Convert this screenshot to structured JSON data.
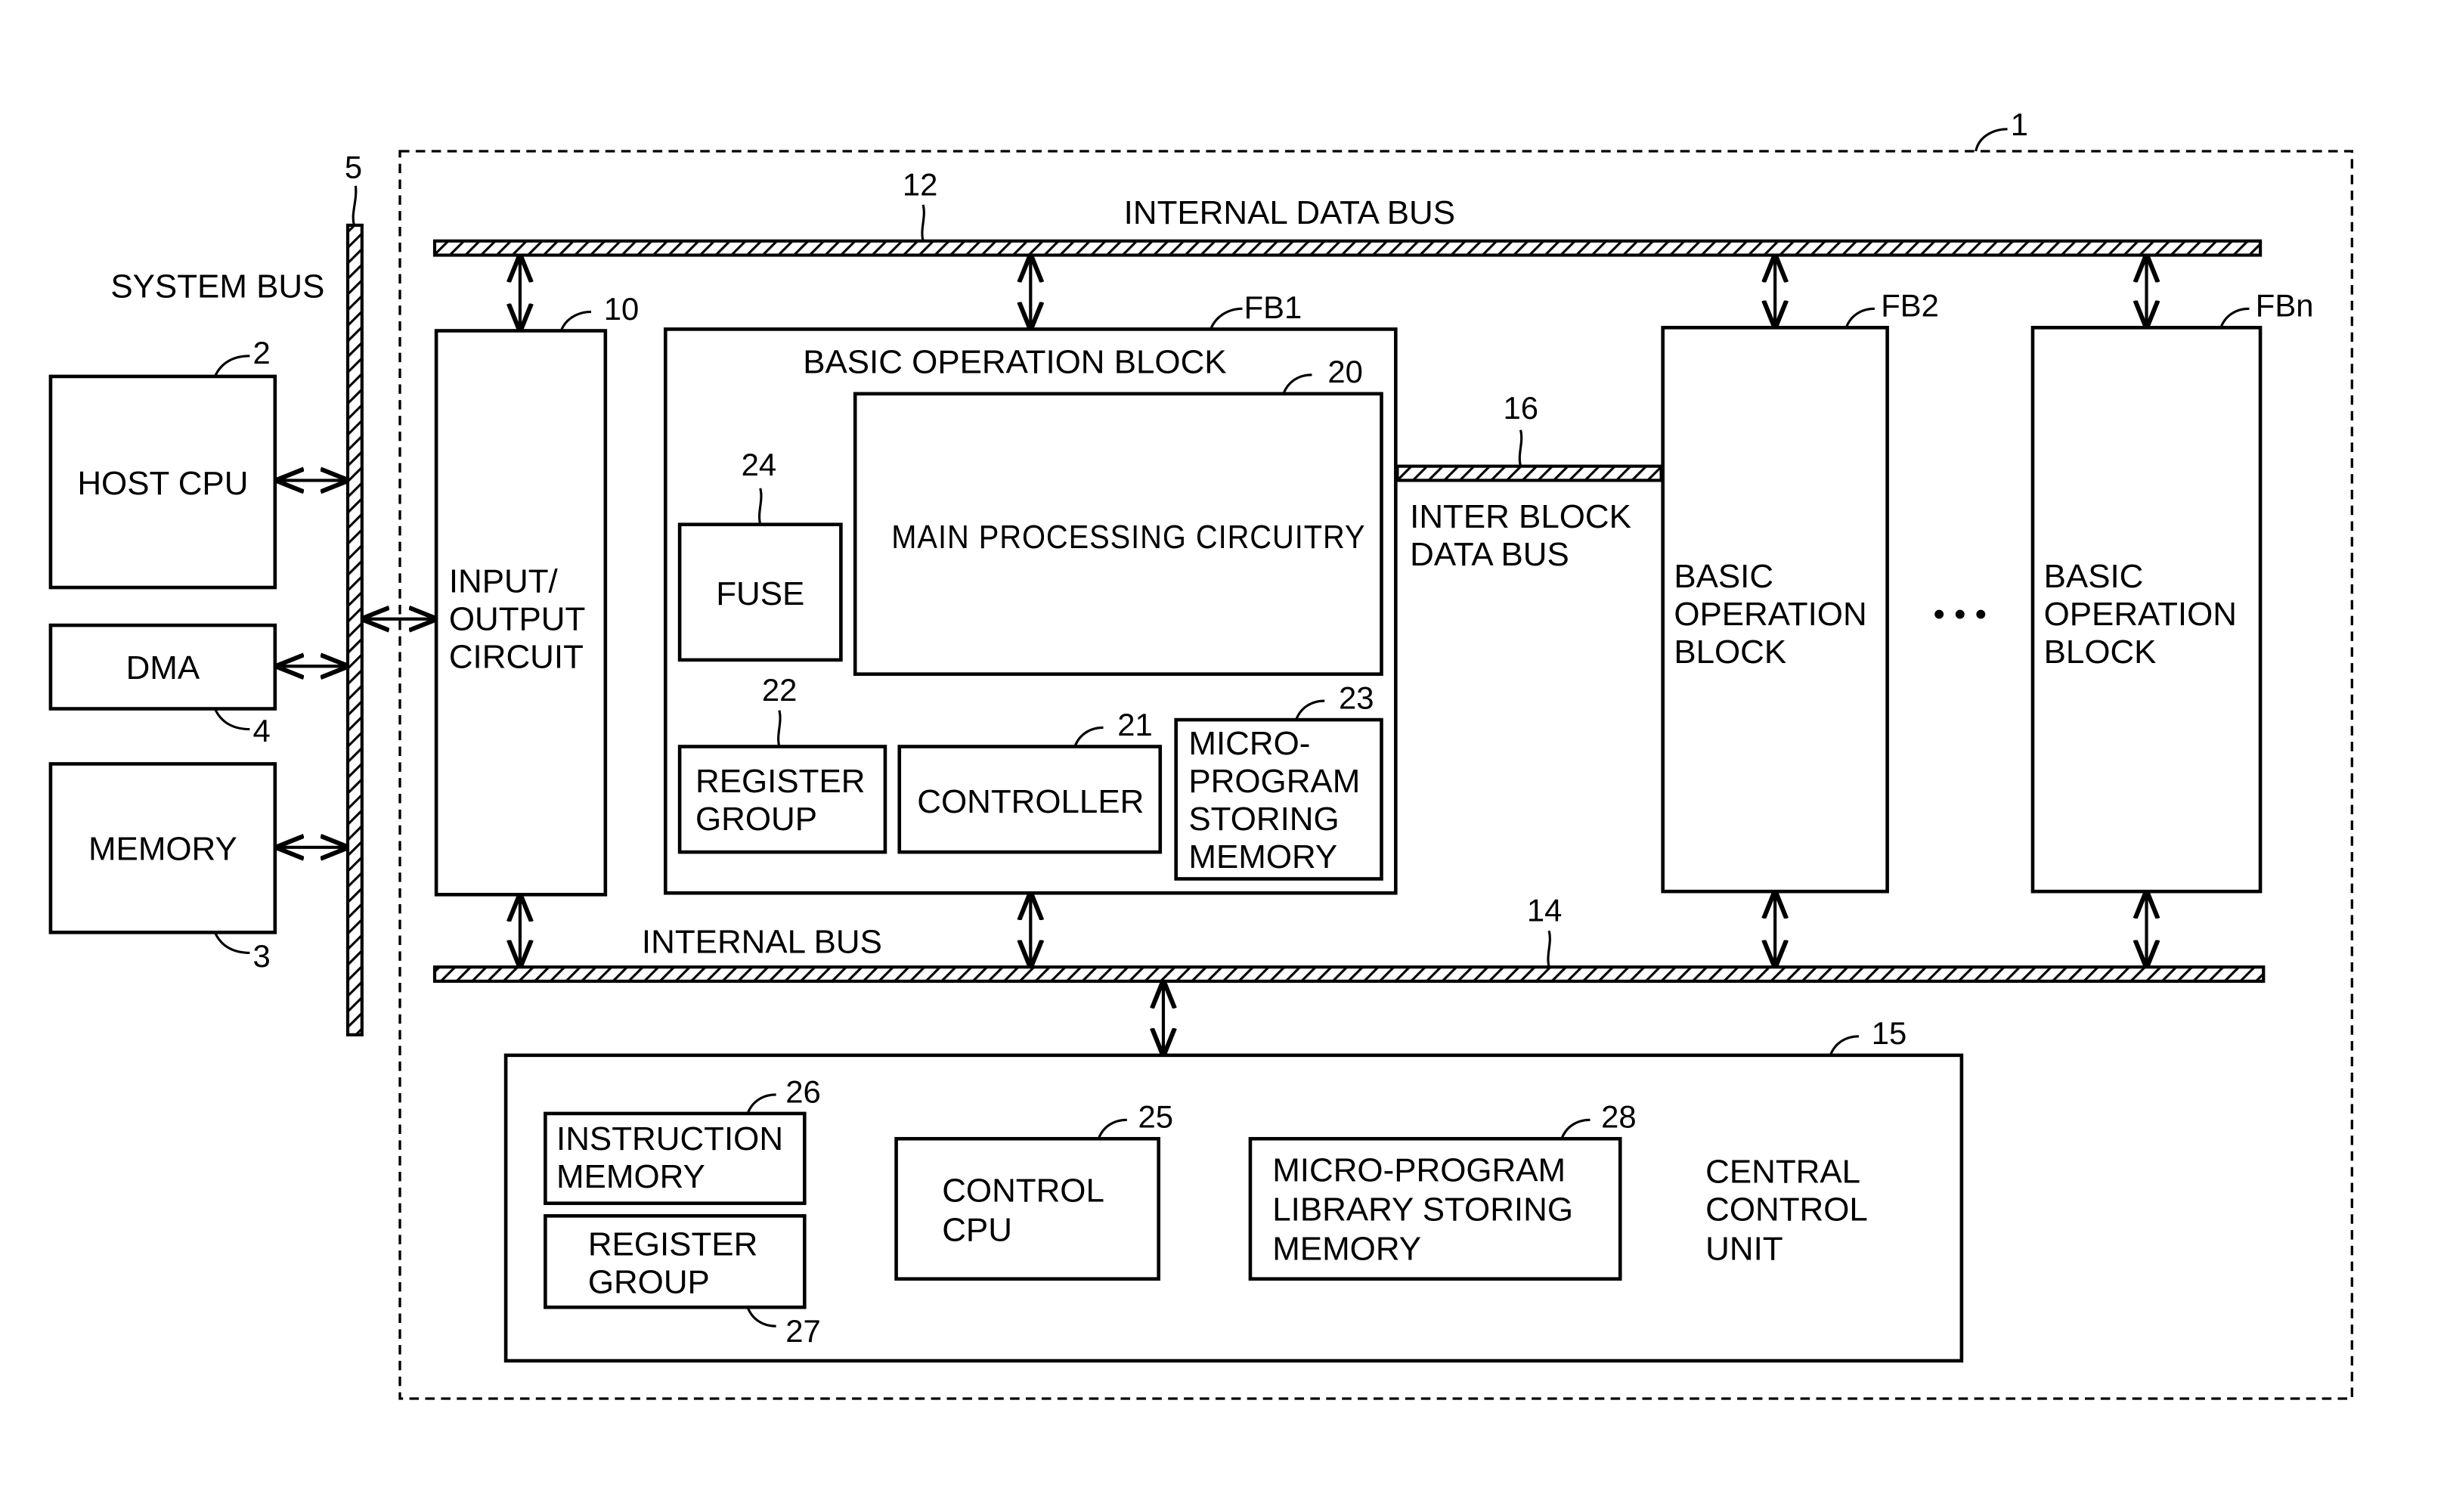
{
  "figure": {
    "reference_chip": "1",
    "system_bus": {
      "label": "SYSTEM BUS",
      "ref": "5"
    },
    "host_cpu": {
      "label": "HOST CPU",
      "ref": "2"
    },
    "dma": {
      "label": "DMA",
      "ref": "4"
    },
    "memory": {
      "label": "MEMORY",
      "ref": "3"
    },
    "internal_data_bus": {
      "label": "INTERNAL DATA BUS",
      "ref": "12"
    },
    "io_circuit": {
      "lines": [
        "INPUT/",
        "OUTPUT",
        "CIRCUIT"
      ],
      "ref": "10"
    },
    "fb1": {
      "title": "BASIC OPERATION BLOCK",
      "ref": "FB1",
      "main_processing": {
        "label": "MAIN PROCESSING CIRCUITRY",
        "ref": "20"
      },
      "fuse": {
        "label": "FUSE",
        "ref": "24"
      },
      "register_group": {
        "lines": [
          "REGISTER",
          "GROUP"
        ],
        "ref": "22"
      },
      "controller": {
        "label": "CONTROLLER",
        "ref": "21"
      },
      "microprogram_memory": {
        "lines": [
          "MICRO-",
          "PROGRAM",
          "STORING",
          "MEMORY"
        ],
        "ref": "23"
      }
    },
    "inter_block_bus": {
      "lines": [
        "INTER BLOCK",
        "DATA BUS"
      ],
      "ref": "16"
    },
    "fb2": {
      "lines": [
        "BASIC",
        "OPERATION",
        "BLOCK"
      ],
      "ref": "FB2"
    },
    "ellipsis": "• • •",
    "fbn": {
      "lines": [
        "BASIC",
        "OPERATION",
        "BLOCK"
      ],
      "ref": "FBn"
    },
    "internal_bus": {
      "label": "INTERNAL BUS",
      "ref": "14"
    },
    "central_control": {
      "lines": [
        "CENTRAL",
        "CONTROL",
        "UNIT"
      ],
      "ref": "15",
      "instruction_memory": {
        "lines": [
          "INSTRUCTION",
          "MEMORY"
        ],
        "ref": "26"
      },
      "register_group": {
        "lines": [
          "REGISTER",
          "GROUP"
        ],
        "ref": "27"
      },
      "control_cpu": {
        "lines": [
          "CONTROL",
          "CPU"
        ],
        "ref": "25"
      },
      "microprogram_library": {
        "lines": [
          "MICRO-PROGRAM",
          "LIBRARY STORING",
          "MEMORY"
        ],
        "ref": "28"
      }
    }
  }
}
